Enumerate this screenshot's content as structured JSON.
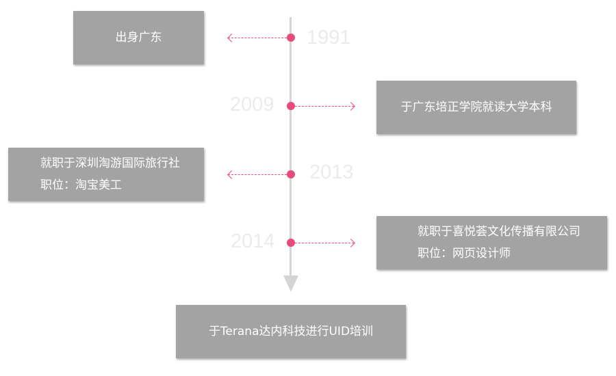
{
  "timeline": {
    "events": [
      {
        "year": "1991",
        "lines": [
          "出身广东"
        ]
      },
      {
        "year": "2009",
        "lines": [
          "于广东培正学院就读大学本科"
        ]
      },
      {
        "year": "2013",
        "lines": [
          "就职于深圳淘游国际旅行社",
          "职位：淘宝美工"
        ]
      },
      {
        "year": "2014",
        "lines": [
          "就职于喜悦荟文化传播有限公司",
          "职位：网页设计师"
        ]
      }
    ],
    "final": {
      "text": "于Terana达内科技进行UID培训"
    },
    "colors": {
      "accent": "#e84a7a",
      "axis": "#d4d4d4",
      "card": "#a3a3a3",
      "year_text": "#ebebeb"
    }
  }
}
